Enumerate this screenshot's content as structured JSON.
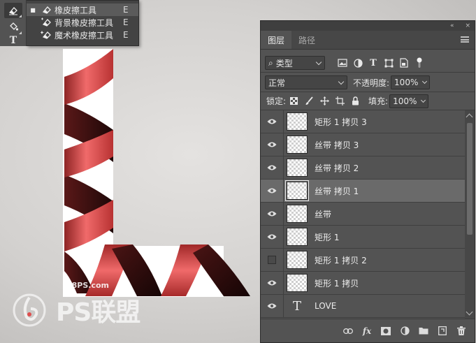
{
  "toolbar": {
    "tools": [
      {
        "icon": "eraser-icon",
        "active": true
      },
      {
        "icon": "paint-bucket-icon",
        "active": false
      },
      {
        "icon": "type-tool-icon",
        "glyph": "T",
        "active": false
      }
    ]
  },
  "flyout": {
    "items": [
      {
        "label": "橡皮擦工具",
        "shortcut": "E",
        "icon": "eraser-icon",
        "selected": true
      },
      {
        "label": "背景橡皮擦工具",
        "shortcut": "E",
        "icon": "background-eraser-icon",
        "selected": false
      },
      {
        "label": "魔术橡皮擦工具",
        "shortcut": "E",
        "icon": "magic-eraser-icon",
        "selected": false
      }
    ]
  },
  "watermark": {
    "url": "68PS.com",
    "brand": "PS联盟"
  },
  "panel": {
    "topbar": {
      "collapse": "«",
      "close": "×"
    },
    "tabs": [
      {
        "label": "图层",
        "active": true
      },
      {
        "label": "路径",
        "active": false
      }
    ],
    "filter": {
      "search_icon": "⌕",
      "kind_label": "类型",
      "icons": [
        "image-filter-icon",
        "adjustment-filter-icon",
        "type-filter-icon",
        "shape-filter-icon",
        "smart-object-filter-icon",
        "filter-toggle-icon"
      ]
    },
    "blend": {
      "mode": "正常",
      "opacity_label": "不透明度:",
      "opacity_value": "100%"
    },
    "lock": {
      "label": "锁定:",
      "icons": [
        "lock-transparent-pixels-icon",
        "lock-image-pixels-icon",
        "lock-position-icon",
        "lock-artboard-icon",
        "lock-all-icon"
      ],
      "fill_label": "填充:",
      "fill_value": "100%"
    },
    "layers": [
      {
        "name": "矩形 1 拷贝 3",
        "visible": true,
        "selected": false,
        "kind": "pixel"
      },
      {
        "name": "丝带 拷贝 3",
        "visible": true,
        "selected": false,
        "kind": "pixel"
      },
      {
        "name": "丝带 拷贝 2",
        "visible": true,
        "selected": false,
        "kind": "pixel"
      },
      {
        "name": "丝带 拷贝 1",
        "visible": true,
        "selected": true,
        "kind": "pixel"
      },
      {
        "name": "丝带",
        "visible": true,
        "selected": false,
        "kind": "pixel"
      },
      {
        "name": "矩形 1",
        "visible": true,
        "selected": false,
        "kind": "pixel"
      },
      {
        "name": "矩形 1 拷贝 2",
        "visible": false,
        "selected": false,
        "kind": "pixel"
      },
      {
        "name": "矩形 1 拷贝",
        "visible": true,
        "selected": false,
        "kind": "pixel"
      },
      {
        "name": "LOVE",
        "visible": true,
        "selected": false,
        "kind": "text"
      }
    ],
    "footer": [
      "link-layers-icon",
      "fx-icon",
      "add-mask-icon",
      "new-adjustment-icon",
      "new-group-icon",
      "new-layer-icon",
      "delete-layer-icon"
    ],
    "footer_fx": "fx"
  },
  "colors": {
    "ribbon_light": "#f06a6a",
    "ribbon_mid": "#c43a3a",
    "ribbon_dark": "#2a0c0c",
    "panel_bg": "#535353"
  }
}
